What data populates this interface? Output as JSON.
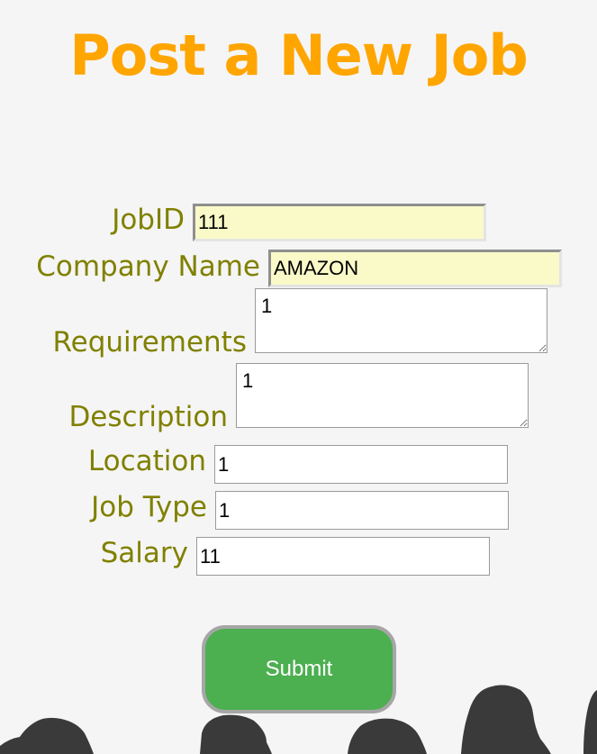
{
  "page": {
    "title": "Post a New Job"
  },
  "form": {
    "job_id": {
      "label": "JobID",
      "value": "111"
    },
    "company_name": {
      "label": "Company Name",
      "value": "AMAZON"
    },
    "requirements": {
      "label": "Requirements",
      "value": "1"
    },
    "description": {
      "label": "Description",
      "value": "1"
    },
    "location": {
      "label": "Location",
      "value": "1"
    },
    "job_type": {
      "label": "Job Type",
      "value": "1"
    },
    "salary": {
      "label": "Salary",
      "value": "11"
    },
    "submit_label": "Submit"
  },
  "colors": {
    "title": "#ffa500",
    "label": "#808000",
    "submit_bg": "#4caf50",
    "autofill_bg": "#fafac8",
    "background": "#f5f5f5",
    "silhouettes": "#3a3a3a"
  }
}
